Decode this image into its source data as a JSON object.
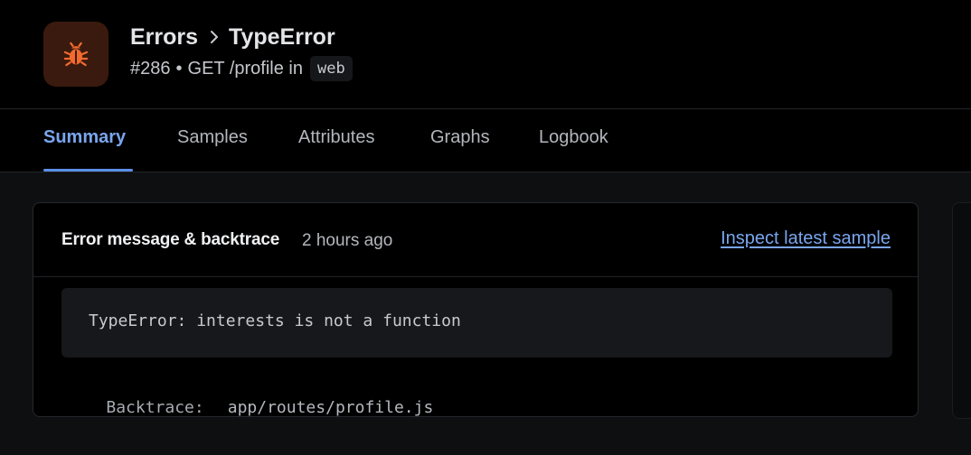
{
  "header": {
    "breadcrumb": [
      "Errors",
      "TypeError"
    ],
    "issue_number": "#286",
    "separator": "•",
    "action": "GET /profile in",
    "environment": "web",
    "icon": "bug-icon",
    "accent_color": "#f26a2e"
  },
  "tabs": [
    {
      "label": "Summary",
      "active": true
    },
    {
      "label": "Samples",
      "active": false
    },
    {
      "label": "Attributes",
      "active": false
    },
    {
      "label": "Graphs",
      "active": false
    },
    {
      "label": "Logbook",
      "active": false
    }
  ],
  "card": {
    "title": "Error message & backtrace",
    "time": "2 hours ago",
    "link": "Inspect latest sample",
    "message": "TypeError: interests is not a function",
    "backtrace_label": "Backtrace:",
    "backtrace_path": "app/routes/profile.js"
  },
  "colors": {
    "link": "#79a6ee",
    "active_tab": "#7aa6ee"
  }
}
